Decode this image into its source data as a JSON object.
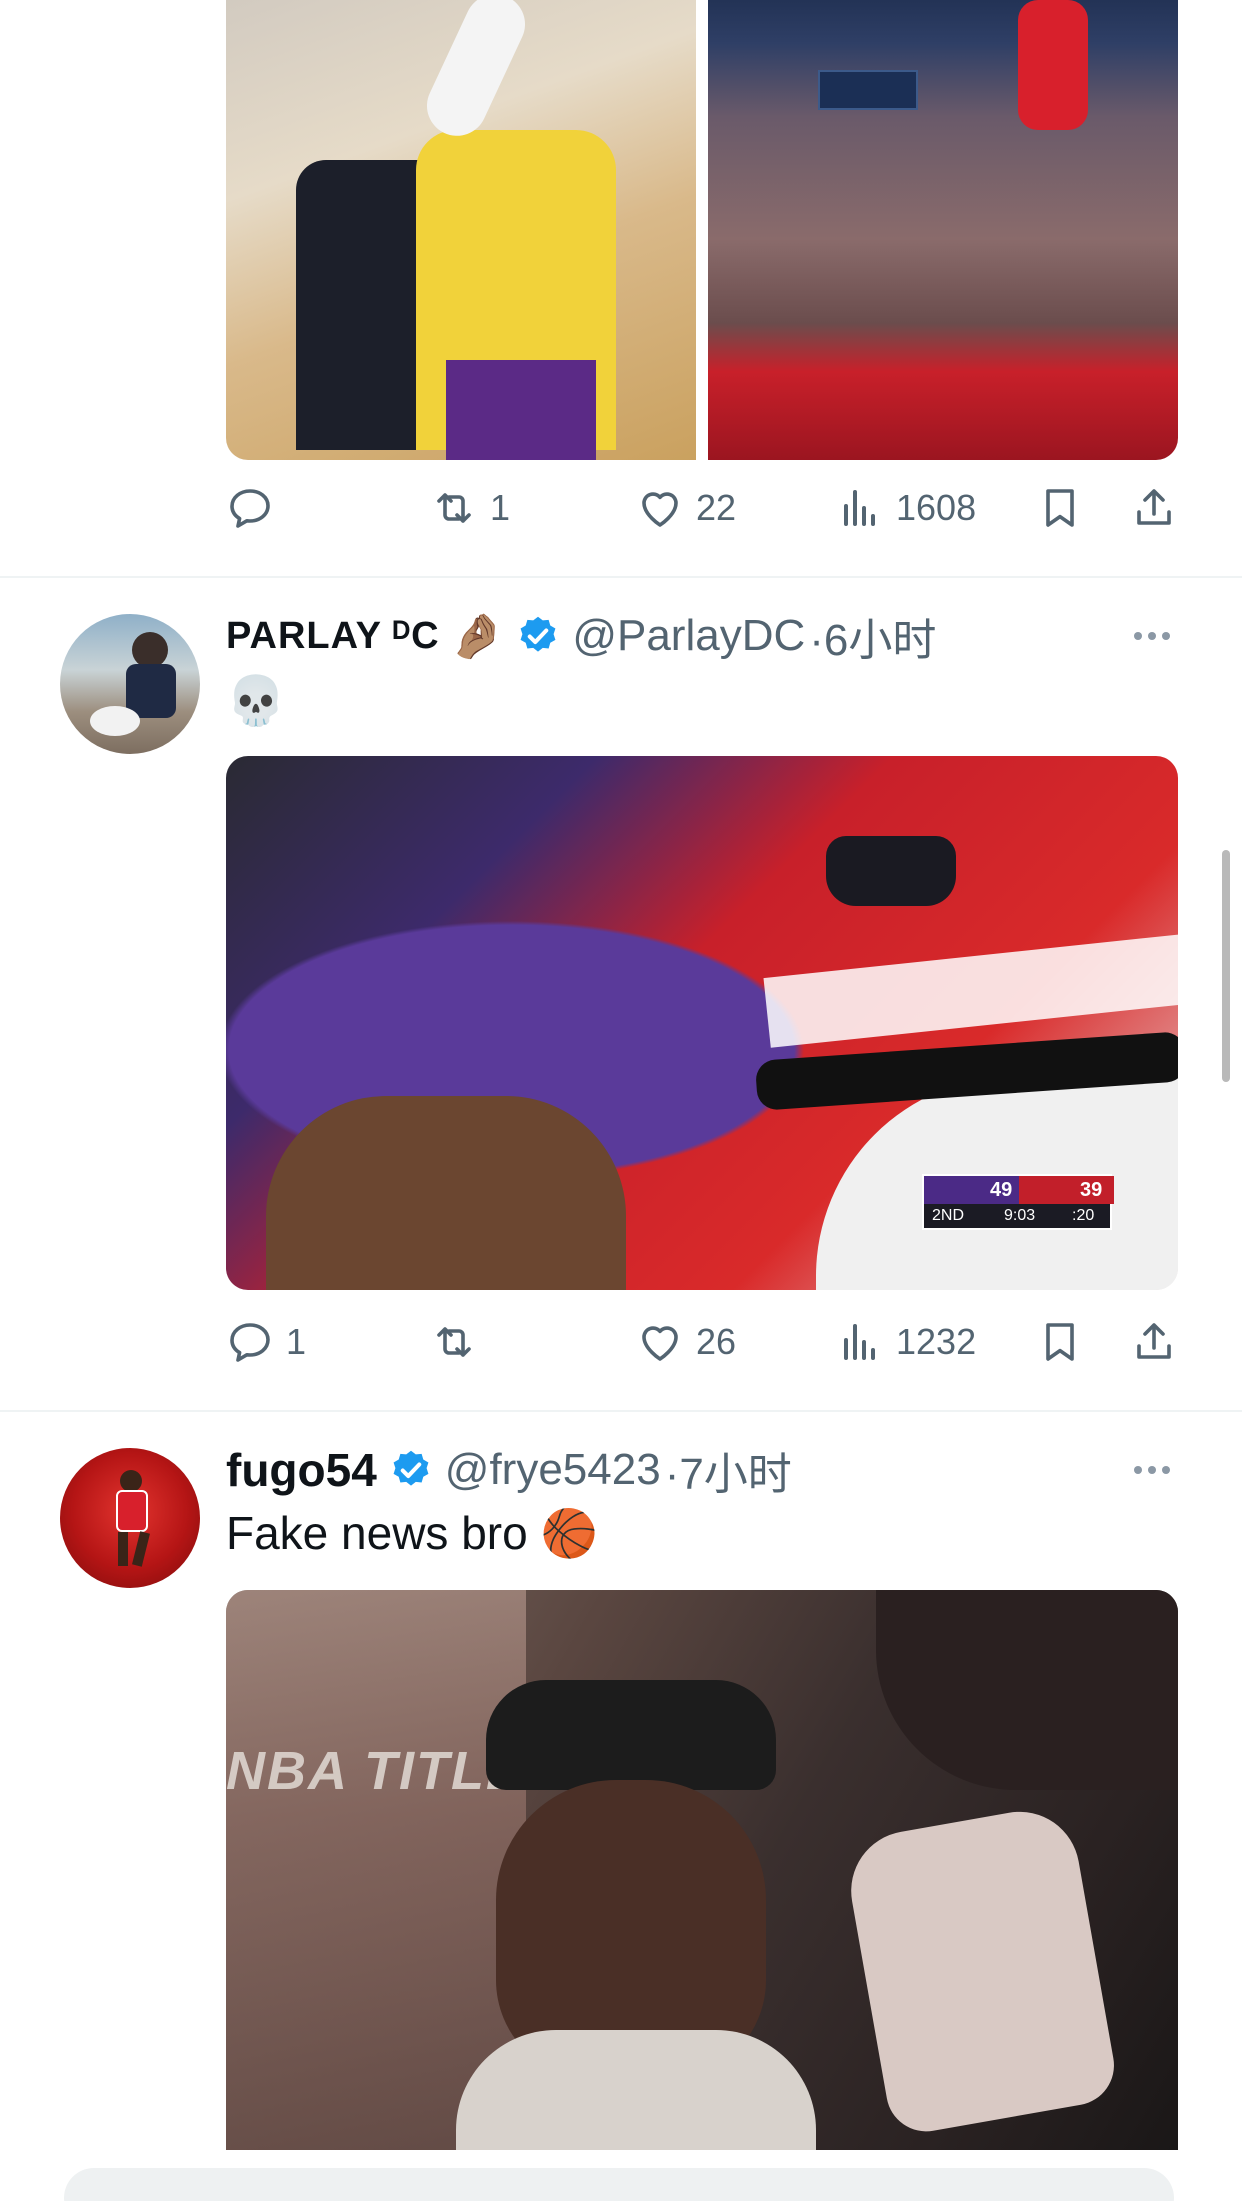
{
  "tweets": [
    {
      "actions": {
        "replies": "",
        "retweets": "1",
        "likes": "22",
        "views": "1608"
      }
    },
    {
      "display_name": "PARLAY ᴰC",
      "name_emoji": "🤌🏽",
      "handle": "@ParlayDC",
      "time": "·6小时",
      "text": "💀",
      "scoreboard": {
        "away": "49",
        "home": "39",
        "period": "2ND",
        "clock": "9:03",
        "shot_clock": ":20"
      },
      "actions": {
        "replies": "1",
        "retweets": "",
        "likes": "26",
        "views": "1232"
      }
    },
    {
      "display_name": "fugo54",
      "handle": "@frye5423",
      "time": "·7小时",
      "text": "Fake news bro 🏀",
      "image_caption": "NBA TITLES"
    }
  ],
  "colors": {
    "verified": "#1d9bf0",
    "muted_text": "#536471",
    "divider": "#eff3f4"
  },
  "icons": [
    "reply-icon",
    "retweet-icon",
    "like-icon",
    "views-icon",
    "bookmark-icon",
    "share-icon",
    "verified-badge-icon",
    "more-icon"
  ]
}
